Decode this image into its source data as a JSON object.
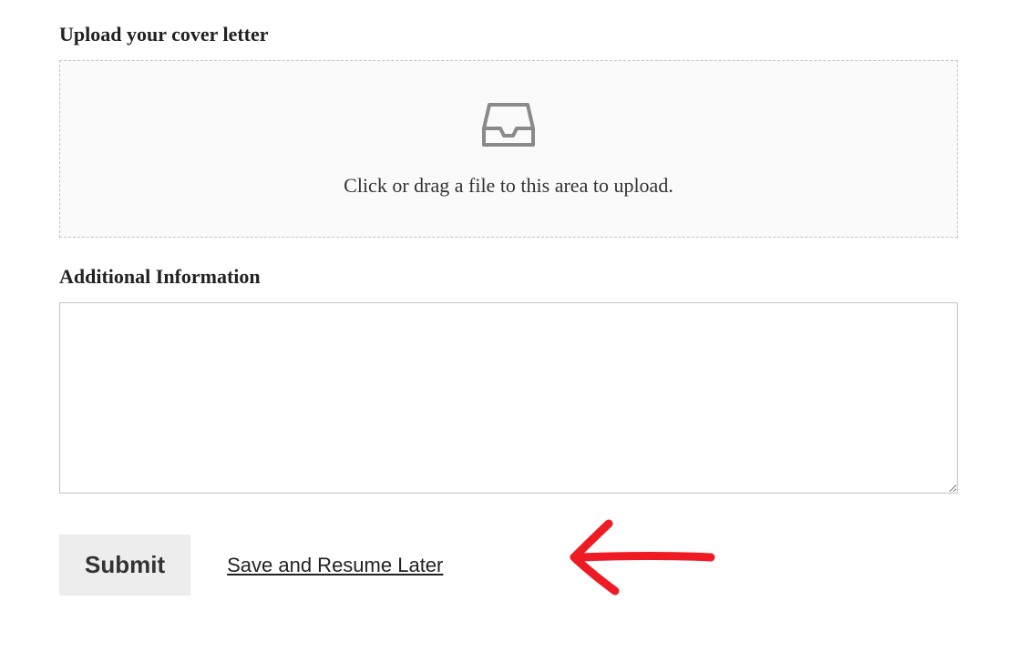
{
  "upload": {
    "label": "Upload your cover letter",
    "instruction": "Click or drag a file to this area to upload."
  },
  "additional": {
    "label": "Additional Information",
    "value": ""
  },
  "actions": {
    "submit_label": "Submit",
    "save_link_label": "Save and Resume Later"
  }
}
